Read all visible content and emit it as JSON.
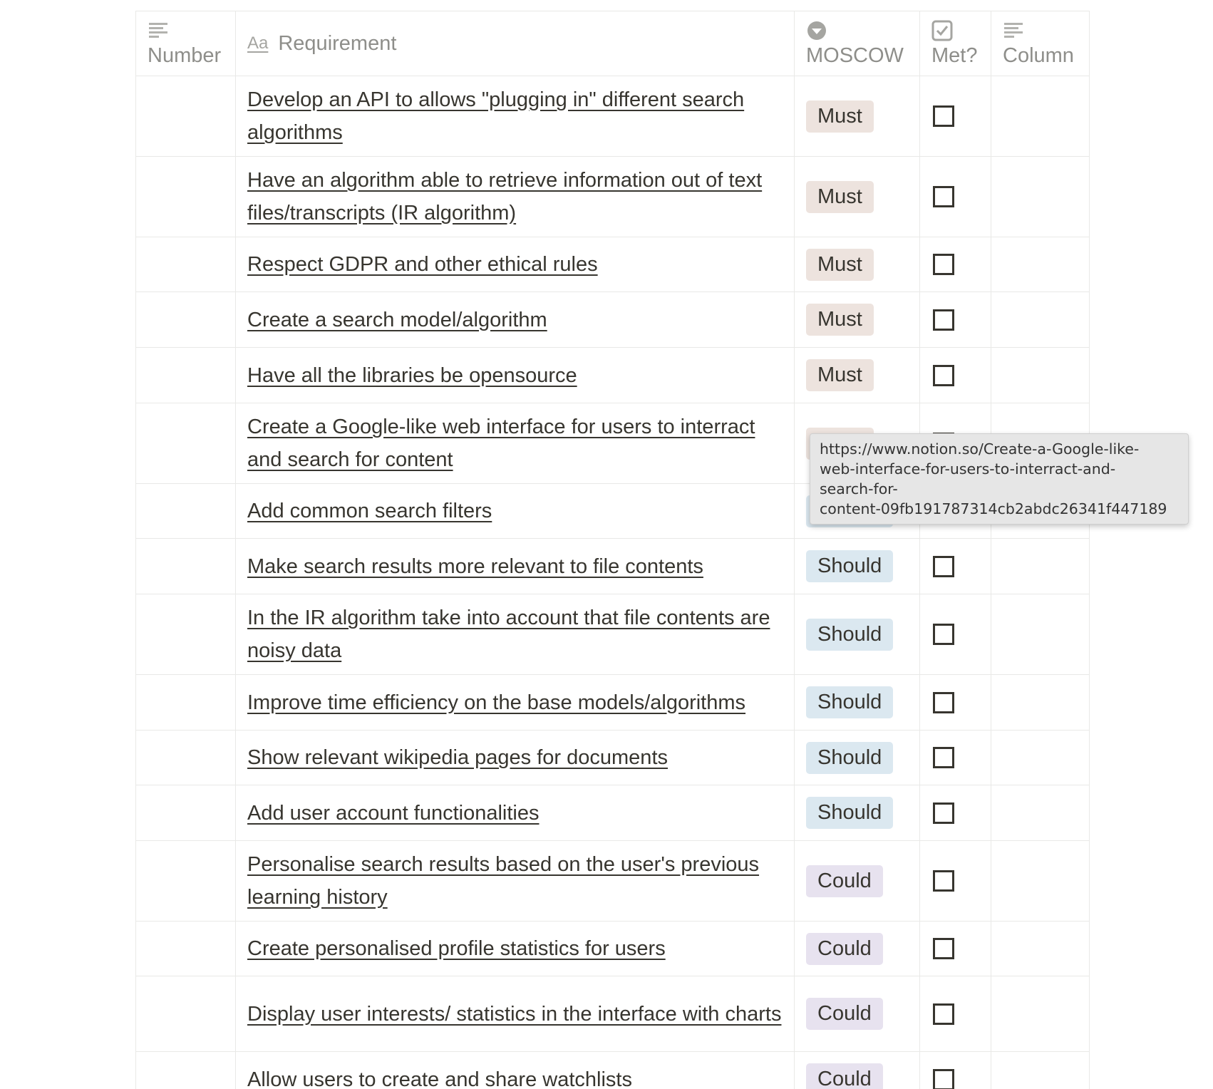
{
  "columns": {
    "number": {
      "label": "Number",
      "icon": "text-lines-icon"
    },
    "requirement": {
      "label": "Requirement",
      "icon": "title-aa-icon",
      "icon_text": "Aa"
    },
    "moscow": {
      "label": "MOSCOW",
      "icon": "select-chevron-icon"
    },
    "met": {
      "label": "Met?",
      "icon": "checkbox-property-icon"
    },
    "column": {
      "label": "Column",
      "icon": "text-lines-icon"
    }
  },
  "tag_colors": {
    "Must": "#ede3de",
    "Should": "#dbe8f0",
    "Could": "#e7e2ef"
  },
  "rows": [
    {
      "requirement": "Develop an API to allows \"plugging in\" different search algorithms",
      "moscow": "Must",
      "met": false
    },
    {
      "requirement": "Have an algorithm able to retrieve information out of text files/transcripts (IR algorithm)",
      "moscow": "Must",
      "met": false
    },
    {
      "requirement": "Respect GDPR and other ethical rules",
      "moscow": "Must",
      "met": false
    },
    {
      "requirement": "Create a search model/algorithm",
      "moscow": "Must",
      "met": false
    },
    {
      "requirement": "Have all the libraries be opensource",
      "moscow": "Must",
      "met": false
    },
    {
      "requirement": "Create a Google-like web interface for users to interract and search for content",
      "moscow": "Must",
      "met": false
    },
    {
      "requirement": "Add common search filters",
      "moscow": "Should",
      "met": false
    },
    {
      "requirement": "Make search results more relevant to file contents",
      "moscow": "Should",
      "met": false
    },
    {
      "requirement": "In the IR algorithm take into account that file contents are noisy data",
      "moscow": "Should",
      "met": false
    },
    {
      "requirement": "Improve time efficiency on the base models/algorithms",
      "moscow": "Should",
      "met": false
    },
    {
      "requirement": "Show relevant wikipedia pages for documents",
      "moscow": "Should",
      "met": false
    },
    {
      "requirement": "Add user account functionalities",
      "moscow": "Should",
      "met": false
    },
    {
      "requirement": "Personalise search results based on the user's previous learning history",
      "moscow": "Could",
      "met": false
    },
    {
      "requirement": "Create personalised profile statistics for users",
      "moscow": "Could",
      "met": false
    },
    {
      "requirement": "Display user interests/ statistics in the interface with charts",
      "moscow": "Could",
      "met": false
    },
    {
      "requirement": "Allow users to create and share watchlists",
      "moscow": "Could",
      "met": false
    }
  ],
  "tooltip": {
    "lines": [
      "https://www.notion.so/Create-a-Google-like-",
      "web-interface-for-users-to-interract-and-",
      "search-for-",
      "content-09fb191787314cb2abdc26341f447189"
    ]
  }
}
